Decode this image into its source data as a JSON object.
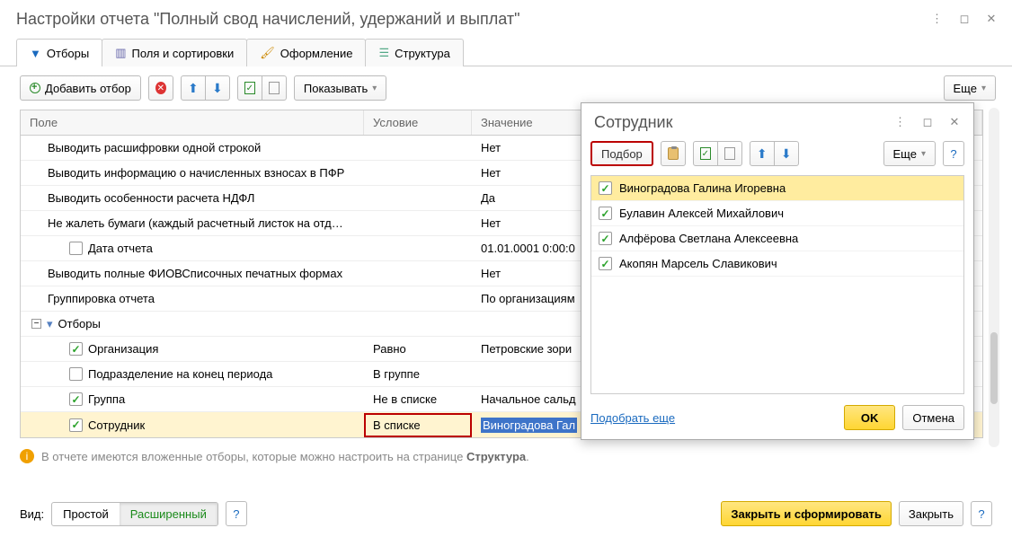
{
  "header": {
    "title": "Настройки отчета \"Полный свод начислений, удержаний и выплат\""
  },
  "tabs": [
    {
      "label": "Отборы"
    },
    {
      "label": "Поля и сортировки"
    },
    {
      "label": "Оформление"
    },
    {
      "label": "Структура"
    }
  ],
  "toolbar": {
    "add_filter": "Добавить отбор",
    "show": "Показывать",
    "more": "Еще"
  },
  "grid": {
    "cols": {
      "field": "Поле",
      "cond": "Условие",
      "value": "Значение"
    },
    "rows": [
      {
        "field": "Выводить расшифровки одной строкой",
        "indent": "f",
        "chk": "none",
        "cond": "",
        "value": "Нет"
      },
      {
        "field": "Выводить информацию о начисленных взносах в ПФР",
        "indent": "f",
        "chk": "none",
        "cond": "",
        "value": "Нет"
      },
      {
        "field": "Выводить особенности расчета НДФЛ",
        "indent": "f",
        "chk": "none",
        "cond": "",
        "value": "Да"
      },
      {
        "field": "Не жалеть бумаги (каждый расчетный листок на отд…",
        "indent": "f",
        "chk": "none",
        "cond": "",
        "value": "Нет"
      },
      {
        "field": "Дата отчета",
        "indent": "i",
        "chk": "off",
        "cond": "",
        "value": "01.01.0001 0:00:0"
      },
      {
        "field": "Выводить полные ФИОВСписочных печатных формах",
        "indent": "f",
        "chk": "none",
        "cond": "",
        "value": "Нет"
      },
      {
        "field": "Группировка отчета",
        "indent": "f",
        "chk": "none",
        "cond": "",
        "value": "По организациям"
      },
      {
        "field": "Отборы",
        "indent": "g",
        "chk": "none",
        "cond": "",
        "value": ""
      },
      {
        "field": "Организация",
        "indent": "i",
        "chk": "on",
        "cond": "Равно",
        "value": "Петровские зори"
      },
      {
        "field": "Подразделение на конец периода",
        "indent": "i",
        "chk": "off",
        "cond": "В группе",
        "value": ""
      },
      {
        "field": "Группа",
        "indent": "i",
        "chk": "on",
        "cond": "Не в списке",
        "value": "Начальное сальд"
      },
      {
        "field": "Сотрудник",
        "indent": "i",
        "chk": "on",
        "cond": "В списке",
        "value": "Виноградова Гал",
        "hl": true,
        "sel": true
      }
    ]
  },
  "info": {
    "text_a": "В отчете имеются вложенные отборы, которые можно настроить на странице ",
    "text_b": "Структура",
    "text_c": "."
  },
  "footer": {
    "view_label": "Вид:",
    "mode_simple": "Простой",
    "mode_ext": "Расширенный",
    "close_form": "Закрыть и сформировать",
    "close": "Закрыть"
  },
  "popup": {
    "title": "Сотрудник",
    "pick": "Подбор",
    "more": "Еще",
    "items": [
      {
        "label": "Виноградова Галина Игоревна",
        "sel": true
      },
      {
        "label": "Булавин Алексей Михайлович",
        "sel": false
      },
      {
        "label": "Алфёрова Светлана Алексеевна",
        "sel": false
      },
      {
        "label": "Акопян Марсель Славикович",
        "sel": false
      }
    ],
    "more_link": "Подобрать еще",
    "ok": "OK",
    "cancel": "Отмена"
  }
}
